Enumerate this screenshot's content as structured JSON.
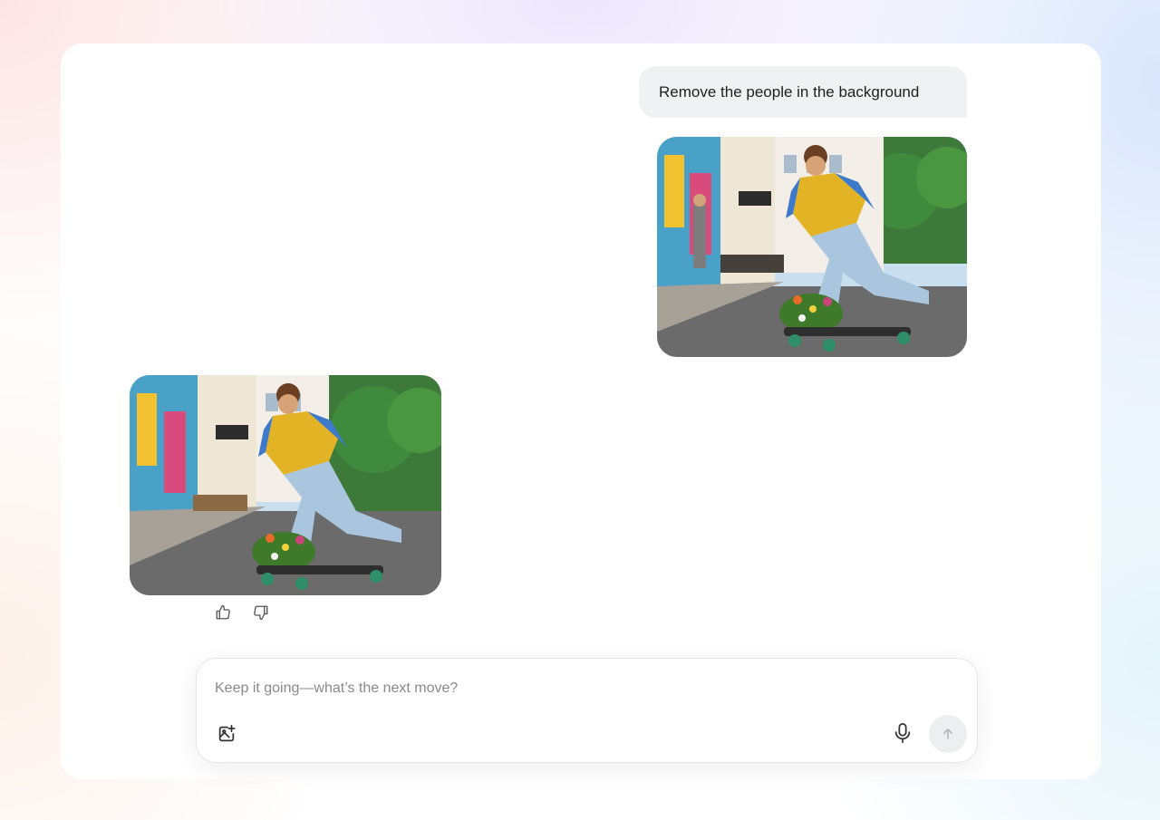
{
  "conversation": {
    "user_message": "Remove the people in the background",
    "user_image_icon": "photo-icon",
    "reply_image_icon": "photo-icon"
  },
  "feedback": {
    "like_icon": "thumbs-up-icon",
    "dislike_icon": "thumbs-down-icon"
  },
  "composer": {
    "placeholder": "Keep it going—what’s the next move?",
    "value": "",
    "attach_icon": "add-image-icon",
    "mic_icon": "microphone-icon",
    "send_icon": "arrow-up-icon"
  },
  "colors": {
    "bubble_bg": "#f0f1f3",
    "send_bg": "#eceef0",
    "icon": "#555555"
  }
}
